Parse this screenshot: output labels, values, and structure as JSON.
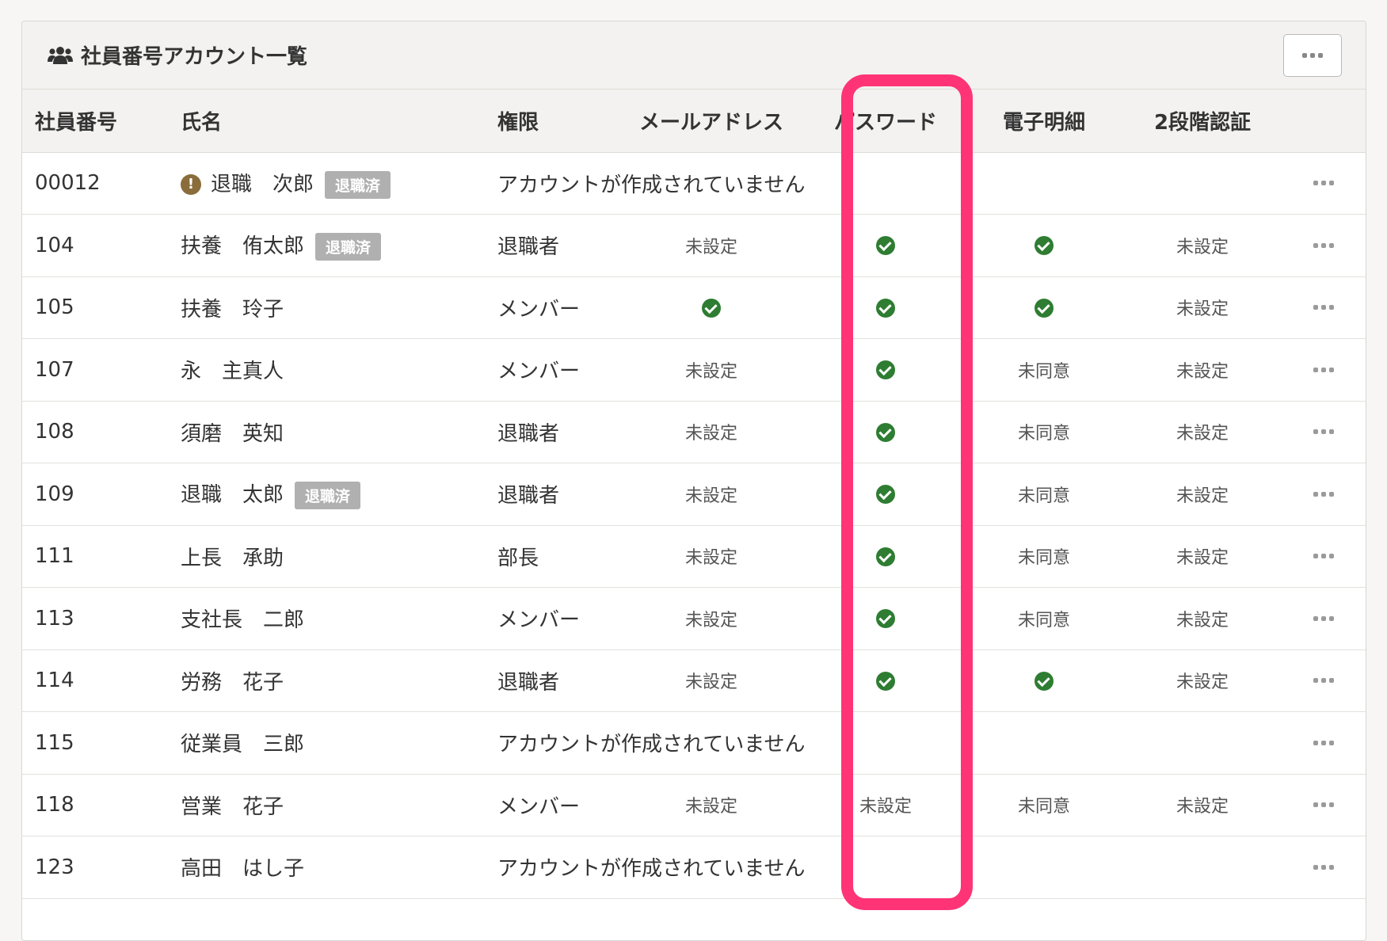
{
  "panel": {
    "title": "社員番号アカウント一覧",
    "title_icon": "users-icon",
    "menu_icon": "ellipsis-icon"
  },
  "columns": [
    "社員番号",
    "氏名",
    "権限",
    "メールアドレス",
    "パスワード",
    "電子明細",
    "2段階認証"
  ],
  "badge_label": "退職済",
  "no_account_text": "アカウントが作成されていません",
  "rows": [
    {
      "id": "00012",
      "name": "退職　次郎",
      "warn": true,
      "badge": true,
      "role": "",
      "email": "",
      "password": "",
      "payslip": "",
      "twofa": "",
      "no_account": true
    },
    {
      "id": "104",
      "name": "扶養　侑太郎",
      "badge": true,
      "role": "退職者",
      "email": "未設定",
      "password": "check",
      "payslip": "check",
      "twofa": "未設定"
    },
    {
      "id": "105",
      "name": "扶養　玲子",
      "role": "メンバー",
      "email": "check",
      "password": "check",
      "payslip": "check",
      "twofa": "未設定"
    },
    {
      "id": "107",
      "name": "永　主真人",
      "role": "メンバー",
      "email": "未設定",
      "password": "check",
      "payslip": "未同意",
      "twofa": "未設定"
    },
    {
      "id": "108",
      "name": "須磨　英知",
      "role": "退職者",
      "email": "未設定",
      "password": "check",
      "payslip": "未同意",
      "twofa": "未設定"
    },
    {
      "id": "109",
      "name": "退職　太郎",
      "badge": true,
      "role": "退職者",
      "email": "未設定",
      "password": "check",
      "payslip": "未同意",
      "twofa": "未設定"
    },
    {
      "id": "111",
      "name": "上長　承助",
      "role": "部長",
      "email": "未設定",
      "password": "check",
      "payslip": "未同意",
      "twofa": "未設定"
    },
    {
      "id": "113",
      "name": "支社長　二郎",
      "role": "メンバー",
      "email": "未設定",
      "password": "check",
      "payslip": "未同意",
      "twofa": "未設定"
    },
    {
      "id": "114",
      "name": "労務　花子",
      "role": "退職者",
      "email": "未設定",
      "password": "check",
      "payslip": "check",
      "twofa": "未設定"
    },
    {
      "id": "115",
      "name": "従業員　三郎",
      "no_account": true
    },
    {
      "id": "118",
      "name": "営業　花子",
      "role": "メンバー",
      "email": "未設定",
      "password": "未設定",
      "payslip": "未同意",
      "twofa": "未設定"
    },
    {
      "id": "123",
      "name": "高田　はし子",
      "no_account": true
    }
  ],
  "colors": {
    "highlight": "#ff3476",
    "check": "#2e7d32",
    "badge": "#b0b0b0",
    "warn": "#8a6d3b"
  }
}
